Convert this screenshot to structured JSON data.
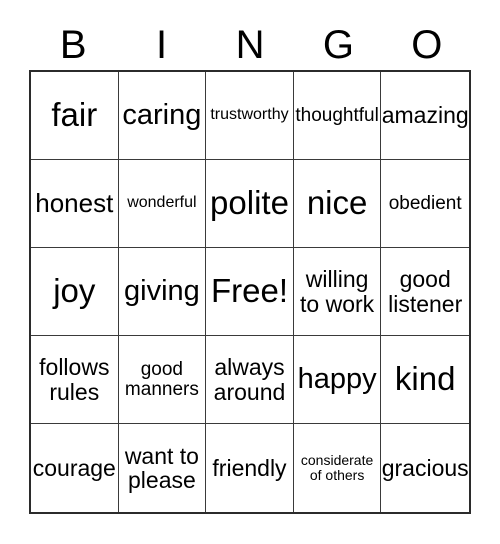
{
  "card": {
    "type": "bingo-card",
    "header_letters": [
      "B",
      "I",
      "N",
      "G",
      "O"
    ],
    "columns": 5,
    "rows": 5,
    "colors": {
      "background": "#ffffff",
      "text": "#000000",
      "outer_border": "#2b2b2b",
      "inner_border": "#3a3a3a"
    },
    "free_space_index": 12,
    "cells": [
      {
        "text": "fair",
        "size": "xxl"
      },
      {
        "text": "caring",
        "size": "xl"
      },
      {
        "text": "trustworthy",
        "size": "xs"
      },
      {
        "text": "thoughtful",
        "size": "sm"
      },
      {
        "text": "amazing",
        "size": "md"
      },
      {
        "text": "honest",
        "size": "lg"
      },
      {
        "text": "wonderful",
        "size": "xs"
      },
      {
        "text": "polite",
        "size": "xxl"
      },
      {
        "text": "nice",
        "size": "xxl"
      },
      {
        "text": "obedient",
        "size": "sm"
      },
      {
        "text": "joy",
        "size": "xxl"
      },
      {
        "text": "giving",
        "size": "xl"
      },
      {
        "text": "Free!",
        "size": "xxl"
      },
      {
        "text": "willing\nto work",
        "size": "md"
      },
      {
        "text": "good\nlistener",
        "size": "md"
      },
      {
        "text": "follows\nrules",
        "size": "md"
      },
      {
        "text": "good\nmanners",
        "size": "sm"
      },
      {
        "text": "always\naround",
        "size": "md"
      },
      {
        "text": "happy",
        "size": "xl"
      },
      {
        "text": "kind",
        "size": "xxl"
      },
      {
        "text": "courage",
        "size": "md"
      },
      {
        "text": "want to\nplease",
        "size": "md"
      },
      {
        "text": "friendly",
        "size": "md"
      },
      {
        "text": "considerate\nof others",
        "size": "xxs"
      },
      {
        "text": "gracious",
        "size": "md"
      }
    ]
  }
}
